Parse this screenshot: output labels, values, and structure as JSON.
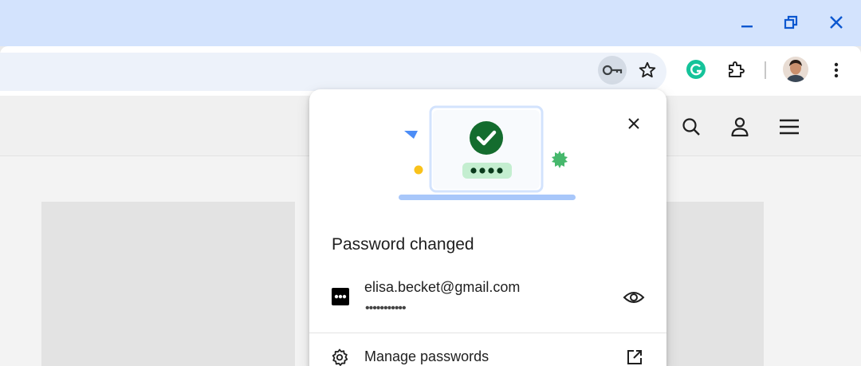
{
  "window": {
    "titlebar_color": "#d3e3fd",
    "controls": [
      "minimize-icon",
      "restore-icon",
      "close-icon"
    ],
    "accent": "#0b57d0"
  },
  "toolbar": {
    "icons": [
      "key-icon",
      "star-icon",
      "grammarly-extension-icon",
      "extensions-puzzle-icon",
      "profile-avatar",
      "more-menu-icon"
    ]
  },
  "page": {
    "header_icons": [
      "search-icon",
      "account-icon",
      "hamburger-menu-icon"
    ]
  },
  "bubble": {
    "title": "Password changed",
    "credential": {
      "username": "elisa.becket@gmail.com",
      "password_mask": "•••••••••••"
    },
    "manage_label": "Manage passwords",
    "illustration": {
      "check_color": "#146c2e",
      "dots_bg": "#c4eed0",
      "laptop_color": "#a8c7fa"
    }
  }
}
